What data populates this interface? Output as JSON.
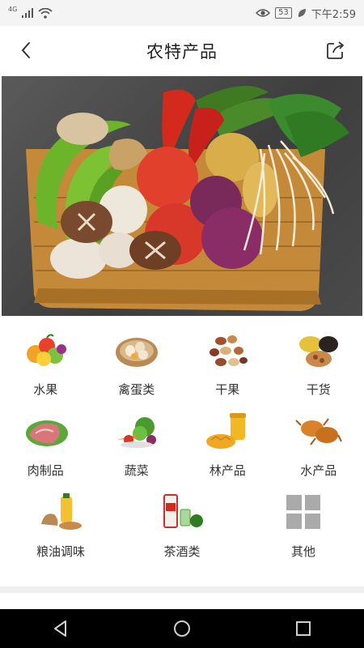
{
  "status_bar": {
    "network": "4G",
    "battery": "53",
    "time": "下午2:59"
  },
  "header": {
    "title": "农特产品",
    "back_icon": "back-arrow-icon",
    "share_icon": "share-icon"
  },
  "categories": [
    {
      "label": "水果",
      "icon": "fruit-icon"
    },
    {
      "label": "禽蛋类",
      "icon": "eggs-icon"
    },
    {
      "label": "干果",
      "icon": "nuts-icon"
    },
    {
      "label": "干货",
      "icon": "dried-goods-icon"
    },
    {
      "label": "肉制品",
      "icon": "meat-icon"
    },
    {
      "label": "蔬菜",
      "icon": "vegetables-icon"
    },
    {
      "label": "林产品",
      "icon": "honey-icon"
    },
    {
      "label": "水产品",
      "icon": "seafood-icon"
    },
    {
      "label": "粮油调味",
      "icon": "grain-oil-icon"
    },
    {
      "label": "茶酒类",
      "icon": "tea-liquor-icon"
    },
    {
      "label": "其他",
      "icon": "grid-other-icon"
    }
  ],
  "colors": {
    "background": "#ffffff",
    "statusbar": "#f4f4f4",
    "navbar": "#000000"
  }
}
